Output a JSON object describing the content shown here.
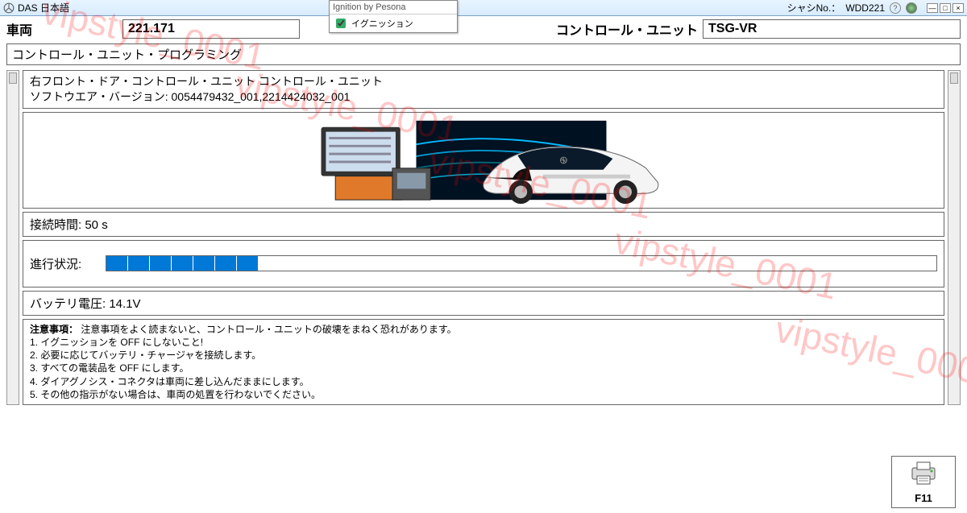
{
  "titlebar": {
    "app_name": "DAS 日本語",
    "chassis_label": "シャシNo.：",
    "chassis_value": "WDD221"
  },
  "dropdown": {
    "title": "Ignition by Pesona",
    "item_label": "イグニッション",
    "item_checked": true
  },
  "toprow": {
    "vehicle_label": "車両",
    "vehicle_value": "221.171",
    "ecu_label": "コントロール・ユニット",
    "ecu_value": "TSG-VR"
  },
  "section_title": "コントロール・ユニット・プログラミング",
  "software_panel": {
    "line1": "右フロント・ドア・コントロール・ユニット コントロール・ユニット",
    "line2_label": "ソフトウエア・バージョン:",
    "line2_value": "0054479432_001,2214424032_001"
  },
  "connection": {
    "label": "接続時間:",
    "value": "50 s"
  },
  "progress": {
    "label": "進行状況:",
    "ticks": 7
  },
  "battery": {
    "label": "バッテリ電圧:",
    "value": "14.1V"
  },
  "notice": {
    "header": "注意事項：",
    "header_text": "注意事項をよく読まないと、コントロール・ユニットの破壊をまねく恐れがあります。",
    "items": [
      "1. イグニッションを OFF にしないこと!",
      "2. 必要に応じてバッテリ・チャージャを接続します。",
      "3. すべての電装品を OFF にします。",
      "4. ダイアグノシス・コネクタは車両に差し込んだままにします。",
      "5. その他の指示がない場合は、車両の処置を行わないでください。"
    ]
  },
  "footer": {
    "f11_label": "F11"
  },
  "watermark_text": "vipstyle_0001"
}
